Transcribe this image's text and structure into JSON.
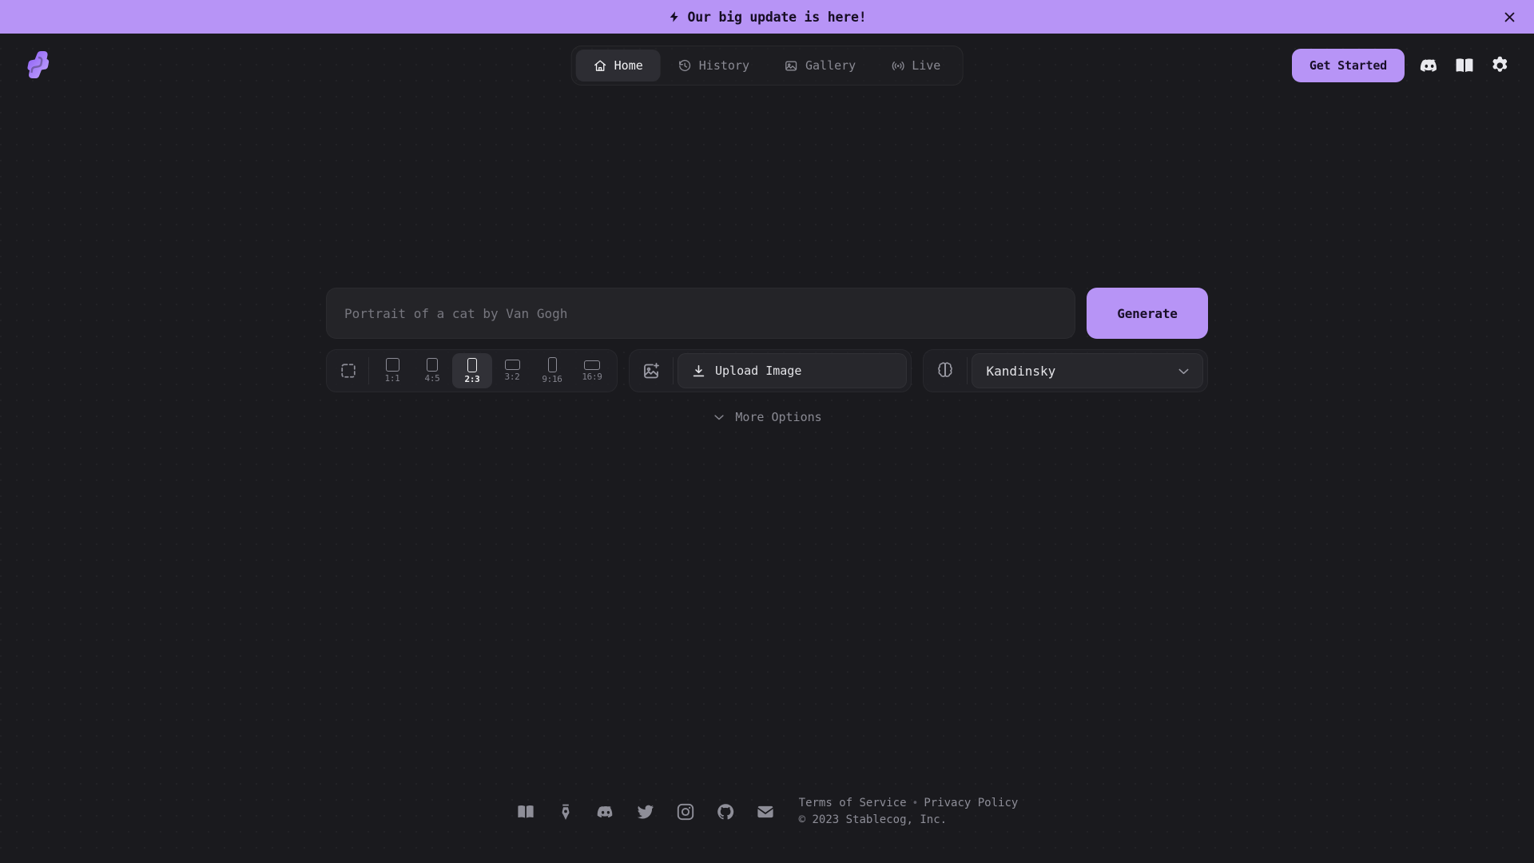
{
  "banner": {
    "icon": "bolt-icon",
    "text": "Our big update is here!",
    "close_icon": "close-icon",
    "bg_color": "#b794f6"
  },
  "header": {
    "logo_icon": "stablecog-logo",
    "nav": [
      {
        "label": "Home",
        "icon": "home-icon",
        "active": true
      },
      {
        "label": "History",
        "icon": "history-icon",
        "active": false
      },
      {
        "label": "Gallery",
        "icon": "gallery-icon",
        "active": false
      },
      {
        "label": "Live",
        "icon": "live-icon",
        "active": false
      }
    ],
    "get_started_label": "Get Started",
    "icons": [
      {
        "name": "discord-icon"
      },
      {
        "name": "book-icon"
      },
      {
        "name": "gear-icon"
      }
    ],
    "accent_color": "#b794f6"
  },
  "main": {
    "prompt_placeholder": "Portrait of a cat by Van Gogh",
    "prompt_value": "",
    "generate_label": "Generate",
    "aspect": {
      "custom_icon": "custom-size-icon",
      "options": [
        {
          "label": "1:1",
          "w": 17,
          "h": 17,
          "selected": false
        },
        {
          "label": "4:5",
          "w": 14,
          "h": 17,
          "selected": false
        },
        {
          "label": "2:3",
          "w": 12,
          "h": 18,
          "selected": true
        },
        {
          "label": "3:2",
          "w": 19,
          "h": 13,
          "selected": false
        },
        {
          "label": "9:16",
          "w": 11,
          "h": 19,
          "selected": false
        },
        {
          "label": "16:9",
          "w": 20,
          "h": 12,
          "selected": false
        }
      ]
    },
    "upload": {
      "panel_icon": "image-plus-icon",
      "button_icon": "upload-arrow-icon",
      "button_label": "Upload Image"
    },
    "model": {
      "panel_icon": "brain-icon",
      "selected": "Kandinsky",
      "chevron_icon": "chevron-down-icon"
    },
    "more_options": {
      "label": "More Options",
      "icon": "chevron-down-icon"
    }
  },
  "footer": {
    "social": [
      {
        "name": "book-icon"
      },
      {
        "name": "pen-nib-icon"
      },
      {
        "name": "discord-icon"
      },
      {
        "name": "twitter-icon"
      },
      {
        "name": "instagram-icon"
      },
      {
        "name": "github-icon"
      },
      {
        "name": "mail-icon"
      }
    ],
    "terms_label": "Terms of Service",
    "separator": "•",
    "privacy_label": "Privacy Policy",
    "copyright": "© 2023 Stablecog, Inc."
  }
}
